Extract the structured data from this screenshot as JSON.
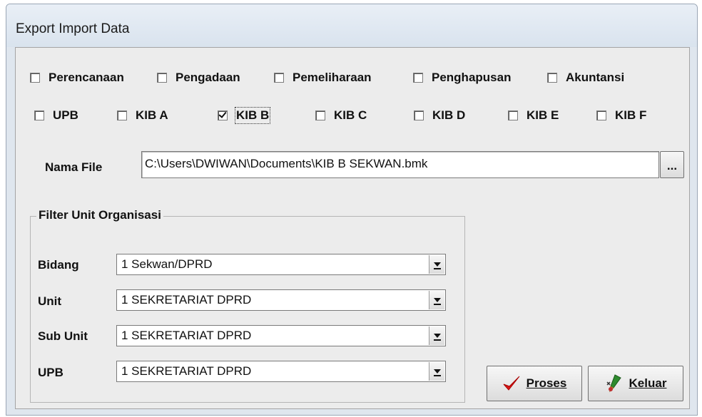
{
  "window": {
    "title": "Export Import Data"
  },
  "modules": [
    {
      "label": "Perencanaan",
      "checked": false
    },
    {
      "label": "Pengadaan",
      "checked": false
    },
    {
      "label": "Pemeliharaan",
      "checked": false
    },
    {
      "label": "Penghapusan",
      "checked": false
    },
    {
      "label": "Akuntansi",
      "checked": false
    }
  ],
  "kib": [
    {
      "label": "UPB",
      "checked": false
    },
    {
      "label": "KIB A",
      "checked": false
    },
    {
      "label": "KIB B",
      "checked": true
    },
    {
      "label": "KIB C",
      "checked": false
    },
    {
      "label": "KIB D",
      "checked": false
    },
    {
      "label": "KIB E",
      "checked": false
    },
    {
      "label": "KIB F",
      "checked": false
    }
  ],
  "file": {
    "label": "Nama File",
    "value": "C:\\Users\\DWIWAN\\Documents\\KIB B SEKWAN.bmk",
    "browse_label": "..."
  },
  "filter": {
    "title": "Filter Unit Organisasi",
    "fields": [
      {
        "label": "Bidang",
        "value": "1  Sekwan/DPRD"
      },
      {
        "label": "Unit",
        "value": "1  SEKRETARIAT  DPRD"
      },
      {
        "label": "Sub Unit",
        "value": "1  SEKRETARIAT  DPRD"
      },
      {
        "label": "UPB",
        "value": "1  SEKRETARIAT  DPRD"
      }
    ]
  },
  "actions": {
    "proses_label": "Proses",
    "keluar_label": "Keluar"
  },
  "colors": {
    "check_red": "#d81818",
    "window_bg": "#ececec"
  },
  "icons": {
    "proses": "checkmark-icon",
    "keluar": "exit-pen-icon"
  }
}
